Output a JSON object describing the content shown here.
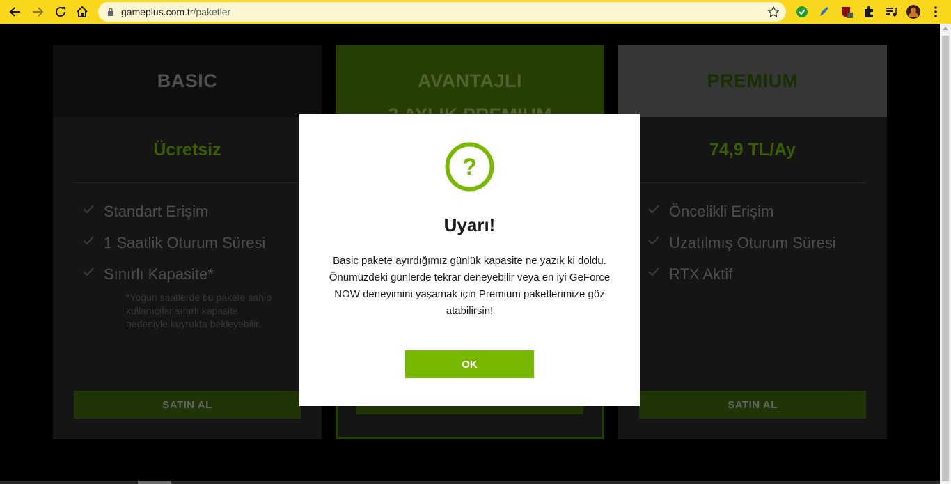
{
  "browser": {
    "url_host": "gameplus.com.tr",
    "url_path": "/paketler",
    "accent": "#f9d71c"
  },
  "plans": [
    {
      "name": "BASIC",
      "price": "Ücretsiz",
      "features": [
        "Standart Erişim",
        "1 Saatlik Oturum Süresi",
        "Sınırlı Kapasite*"
      ],
      "note": "*Yoğun saatlerde bu pakete sahip kullanıcılar sınırlı kapasite nedeniyle kuyrukta bekleyebilir.",
      "button": "SATIN AL"
    },
    {
      "name": "AVANTAJLI",
      "subtitle": "3 AYLIK PREMIUM"
    },
    {
      "name": "PREMIUM",
      "price": "74,9 TL/Ay",
      "features": [
        "Öncelikli Erişim",
        "Uzatılmış Oturum Süresi",
        "RTX Aktif"
      ],
      "button": "SATIN AL"
    }
  ],
  "modal": {
    "title": "Uyarı!",
    "message": "Basic pakete ayırdığımız günlük kapasite ne yazık ki doldu. Önümüzdeki günlerde tekrar deneyebilir veya en iyi GeForce NOW deneyimini yaşamak için Premium paketlerimize göz atabilirsin!",
    "ok_label": "OK",
    "accent": "#76b900"
  }
}
